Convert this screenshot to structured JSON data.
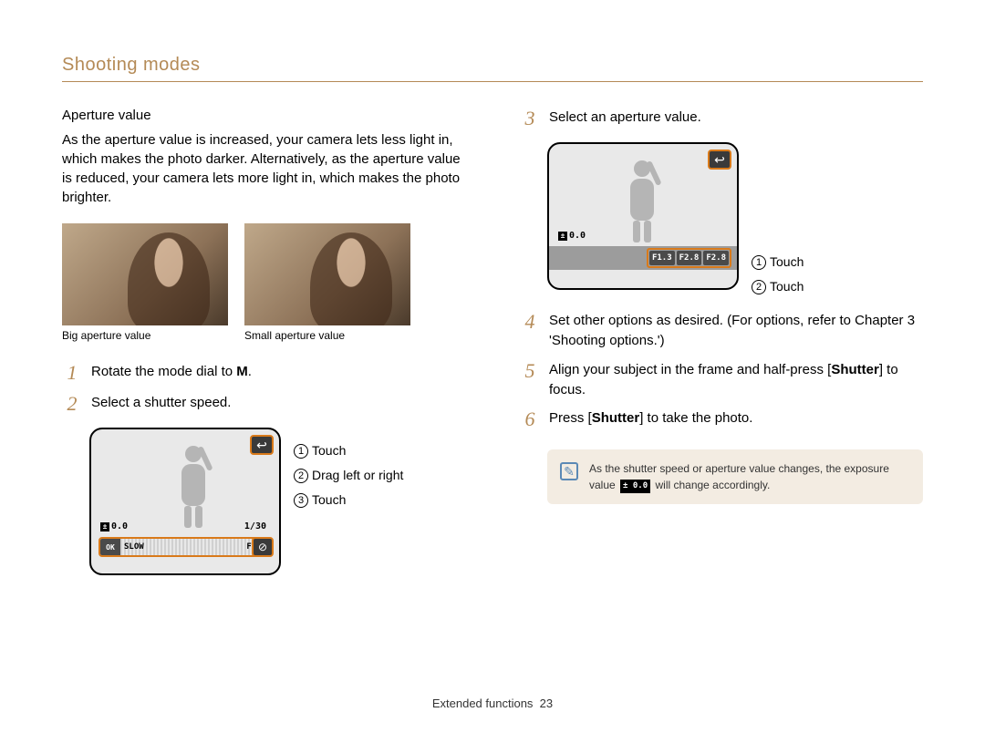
{
  "header": {
    "title": "Shooting modes"
  },
  "left": {
    "subhead": "Aperture value",
    "body": "As the aperture value is increased, your camera lets less light in, which makes the photo darker. Alternatively, as the aperture value is reduced, your camera lets more light in, which makes the photo brighter.",
    "captions": {
      "big": "Big aperture value",
      "small": "Small aperture value"
    },
    "steps": {
      "s1_pre": "Rotate the mode dial to ",
      "s1_mode": "M",
      "s1_post": ".",
      "s2": "Select a shutter speed."
    },
    "screen1": {
      "back_glyph": "↩",
      "ev": "0.0",
      "shutter": "1/30",
      "ok": "OK",
      "slow": "SLOW",
      "fast": "FAST",
      "lock_glyph": "⊘"
    },
    "callouts1": {
      "c1": "Touch",
      "c2": "Drag left or right",
      "c3": "Touch"
    }
  },
  "right": {
    "steps": {
      "s3": "Select an aperture value.",
      "s4": "Set other options as desired. (For options, refer to Chapter 3 'Shooting options.')",
      "s5_pre": "Align your subject in the frame and half-press [",
      "s5_btn": "Shutter",
      "s5_post": "] to focus.",
      "s6_pre": "Press [",
      "s6_btn": "Shutter",
      "s6_post": "] to take the photo."
    },
    "screen2": {
      "back_glyph": "↩",
      "ev": "0.0",
      "ap1": "F1.3",
      "ap2": "F2.8",
      "ap3": "F2.8"
    },
    "callouts2": {
      "c1": "Touch",
      "c2": "Touch"
    },
    "note": {
      "text_pre": "As the shutter speed or aperture value changes, the exposure value ",
      "ev_badge": "0.0",
      "text_post": " will change accordingly."
    }
  },
  "footer": {
    "section": "Extended functions",
    "page": "23"
  },
  "glyphs": {
    "ev_square": "±"
  }
}
